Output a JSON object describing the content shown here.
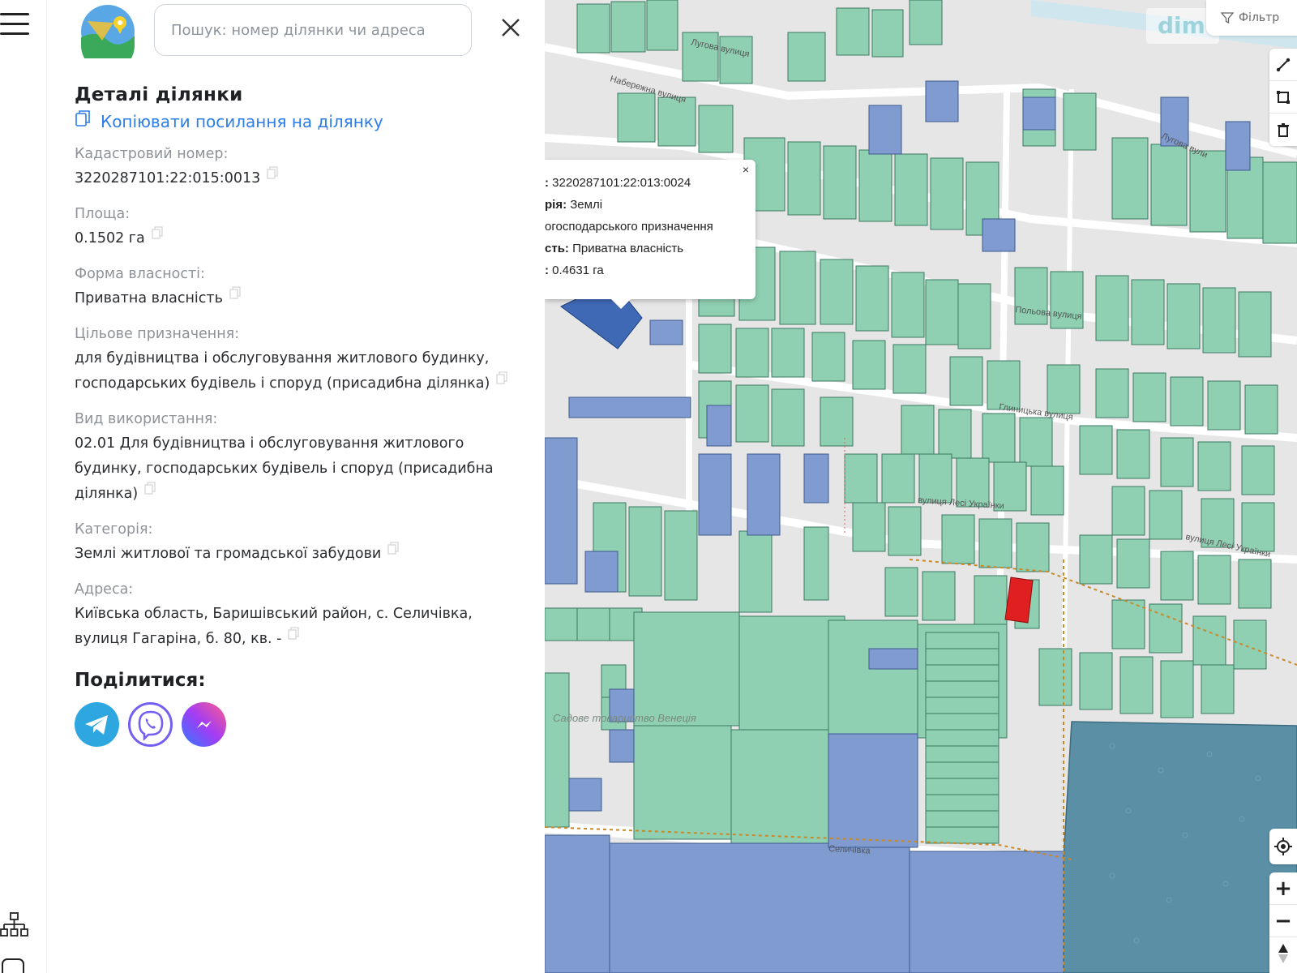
{
  "search": {
    "placeholder": "Пошук: номер ділянки чи адреса"
  },
  "details": {
    "title": "Деталі ділянки",
    "copy_link_label": "Копіювати посилання на ділянку",
    "fields": [
      {
        "label": "Кадастровий номер:",
        "value": "3220287101:22:015:0013"
      },
      {
        "label": "Площа:",
        "value": "0.1502 га"
      },
      {
        "label": "Форма власності:",
        "value": "Приватна власність"
      },
      {
        "label": "Цільове призначення:",
        "value": "для будівництва і обслуговування житлового будинку, господарських будівель і споруд (присадибна ділянка)"
      },
      {
        "label": "Вид використання:",
        "value": "02.01 Для будівництва і обслуговування житлового будинку, господарських будівель і споруд (присадибна ділянка)"
      },
      {
        "label": "Категорія:",
        "value": "Землі житлової та громадської забудови"
      },
      {
        "label": "Адреса:",
        "value": "Київська область, Баришівський район, с. Селичівка, вулиця Гагаріна, б. 80, кв. -"
      }
    ]
  },
  "share": {
    "title": "Поділитися:",
    "buttons": [
      {
        "name": "telegram",
        "color": "#2ea6e0"
      },
      {
        "name": "viber",
        "color": "#7360f2"
      },
      {
        "name": "messenger",
        "color": "#8e3cf7"
      }
    ]
  },
  "map": {
    "watermark": "dim",
    "filter_label": "Фільтр",
    "popup": {
      "close": "×",
      "lines": [
        {
          "key": ":",
          "value": " 3220287101:22:013:0024"
        },
        {
          "key": "рія:",
          "value": " Землі"
        },
        {
          "key": "",
          "value": "огосподарського призначення"
        },
        {
          "key": "сть:",
          "value": " Приватна власність"
        },
        {
          "key": ":",
          "value": " 0.4631 га"
        }
      ]
    },
    "streets": [
      "Лугова вулиця",
      "Набережна вулиця",
      "Лугова вули",
      "Польова вулиця",
      "Глиницька вулиця",
      "вулиця Лесі Українки",
      "вулиця Лесі Українки",
      "Селичівка",
      "Садове товариство Венеція"
    ],
    "zoom_in": "+",
    "zoom_out": "−",
    "colors": {
      "green_parcel": "#8fcfb2",
      "blue_parcel": "#7f9bd0",
      "selected": "#e02020",
      "water": "#5a8fa6"
    }
  }
}
